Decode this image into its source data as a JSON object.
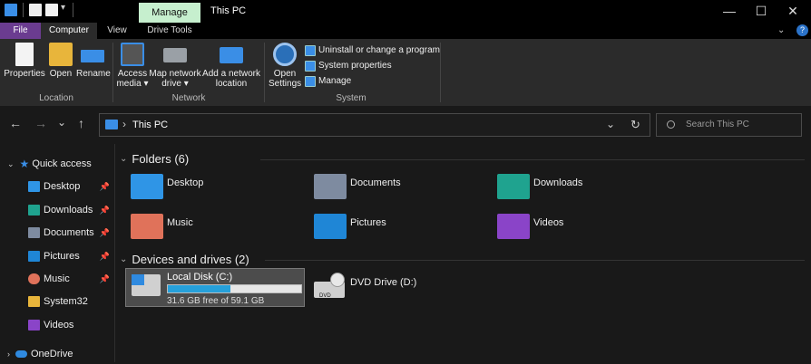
{
  "window": {
    "title": "This PC",
    "context_tab": "Manage",
    "controls": {
      "minimize": "—",
      "maximize": "☐",
      "close": "✕"
    }
  },
  "ribbon_tabs": [
    {
      "label": "File"
    },
    {
      "label": "Computer"
    },
    {
      "label": "View"
    },
    {
      "label": "Drive Tools"
    }
  ],
  "ribbon": {
    "location": {
      "group_label": "Location",
      "buttons": [
        {
          "label": "Properties",
          "icon": "properties-icon"
        },
        {
          "label": "Open",
          "icon": "folder-open-icon"
        },
        {
          "label": "Rename",
          "icon": "rename-icon"
        }
      ]
    },
    "network": {
      "group_label": "Network",
      "buttons": [
        {
          "label1": "Access",
          "label2": "media ▾",
          "icon": "media-icon"
        },
        {
          "label1": "Map network",
          "label2": "drive ▾",
          "icon": "network-drive-icon"
        },
        {
          "label1": "Add a network",
          "label2": "location",
          "icon": "network-location-icon"
        }
      ]
    },
    "system": {
      "group_label": "System",
      "open_settings1": "Open",
      "open_settings2": "Settings",
      "small_buttons": [
        {
          "label": "Uninstall or change a program"
        },
        {
          "label": "System properties"
        },
        {
          "label": "Manage"
        }
      ]
    }
  },
  "nav": {
    "back": "←",
    "forward": "→",
    "recent": "⌄",
    "up": "↑",
    "path_separator": "›",
    "path": "This PC",
    "dropdown": "⌄",
    "refresh": "↻",
    "search_placeholder": "Search This PC"
  },
  "sidebar": {
    "quick_access": "Quick access",
    "items": [
      {
        "label": "Desktop",
        "pinned": true,
        "color": "#2f95e6"
      },
      {
        "label": "Downloads",
        "pinned": true,
        "color": "#1fa38f"
      },
      {
        "label": "Documents",
        "pinned": true,
        "color": "#7e8ba0"
      },
      {
        "label": "Pictures",
        "pinned": true,
        "color": "#1f86d6"
      },
      {
        "label": "Music",
        "pinned": true,
        "color": "#e0725a"
      },
      {
        "label": "System32",
        "pinned": false,
        "color": "#e8b53b"
      },
      {
        "label": "Videos",
        "pinned": false,
        "color": "#8a44c8"
      }
    ],
    "onedrive": "OneDrive"
  },
  "content": {
    "folders_header": "Folders (6)",
    "folders": [
      {
        "label": "Desktop",
        "color": "#2f95e6"
      },
      {
        "label": "Documents",
        "color": "#7e8ba0"
      },
      {
        "label": "Downloads",
        "color": "#1fa38f"
      },
      {
        "label": "Music",
        "color": "#e0725a"
      },
      {
        "label": "Pictures",
        "color": "#1f86d6"
      },
      {
        "label": "Videos",
        "color": "#8a44c8"
      }
    ],
    "drives_header": "Devices and drives (2)",
    "drives": [
      {
        "label": "Local Disk (C:)",
        "free": "31.6 GB free of 59.1 GB",
        "used_fraction": 0.47
      },
      {
        "label": "DVD Drive (D:)",
        "badge": "DVD"
      }
    ]
  },
  "colors": {
    "accent": "#26a0da",
    "file_tab": "#6b3c90",
    "manage_tab": "#c6efce",
    "selection": "#4c4c4c"
  }
}
